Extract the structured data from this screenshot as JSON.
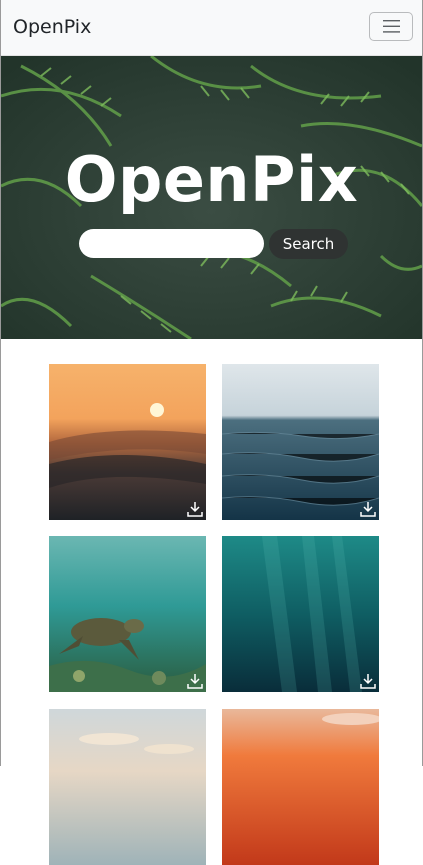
{
  "navbar": {
    "brand": "OpenPix",
    "menu_icon": "hamburger-menu-icon"
  },
  "hero": {
    "title": "OpenPix",
    "search": {
      "value": "",
      "placeholder": "",
      "button_label": "Search"
    }
  },
  "gallery": {
    "download_icon": "download-icon",
    "items": [
      {
        "subject": "sunset-waves"
      },
      {
        "subject": "open-ocean"
      },
      {
        "subject": "sea-turtle"
      },
      {
        "subject": "underwater-light"
      },
      {
        "subject": "beach-sky"
      },
      {
        "subject": "orange-sunset"
      }
    ]
  }
}
